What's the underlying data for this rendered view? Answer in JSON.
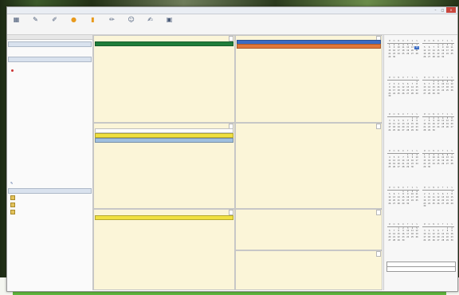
{
  "window": {
    "title": ""
  },
  "toolbar": {
    "buttons": [
      {
        "label": "",
        "icon": "appointment-icon"
      },
      {
        "label": "",
        "icon": "new-icon"
      },
      {
        "label": "",
        "icon": "edit-icon"
      },
      {
        "label": "",
        "icon": "lightbulb-icon"
      },
      {
        "label": "",
        "icon": "tag-icon"
      },
      {
        "label": "",
        "icon": "pencil-icon"
      },
      {
        "label": "",
        "icon": "person-icon"
      },
      {
        "label": "",
        "icon": "write-icon"
      },
      {
        "label": "",
        "icon": "export-icon"
      }
    ]
  },
  "leftpane": {
    "top_header": "",
    "section1": "",
    "section1_items": [
      "",
      "",
      ""
    ],
    "section2": "",
    "section2_items": [
      "",
      ""
    ],
    "section2_red_item": "",
    "blue_row": "",
    "section3": "",
    "groups": [
      "",
      "",
      ""
    ]
  },
  "center": {
    "row1": {
      "left_label": "",
      "right_label": "",
      "events_left": [
        {
          "text": "",
          "color": "#1f7d3a"
        }
      ],
      "events_right": [
        {
          "text": "",
          "color": "#3b6cc4"
        },
        {
          "text": "",
          "color": "#e0773a"
        }
      ]
    },
    "row2": {
      "left_label": "",
      "right_label": "",
      "right_text": "",
      "events_left": [
        {
          "text": "",
          "color": "#ffffff"
        },
        {
          "text": "",
          "color": "#f0e040"
        },
        {
          "text": "",
          "color": "#9fbfdf"
        }
      ]
    },
    "row3": {
      "left_label": "",
      "right_label": "",
      "events_left": [
        {
          "text": "",
          "color": "#f0e040"
        }
      ]
    },
    "row4": {
      "right_label": ""
    }
  },
  "rightpane": {
    "months": [
      "",
      "",
      "",
      "",
      "",
      "",
      "",
      "",
      "",
      "",
      "",
      ""
    ],
    "weekdays": [
      "M",
      "D",
      "M",
      "D",
      "F",
      "S",
      "S"
    ],
    "today_label": "",
    "week_label": ""
  },
  "colors": {
    "event_green": "#1f7d3a",
    "event_blue": "#3b6cc4",
    "event_orange": "#e0773a",
    "event_yellow": "#f0e040",
    "cell_bg": "#fbf5d8"
  }
}
